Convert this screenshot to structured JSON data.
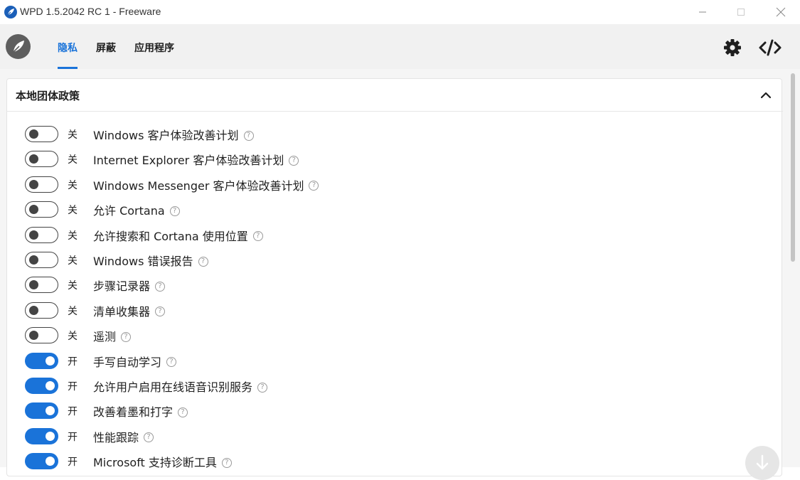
{
  "window": {
    "title": "WPD 1.5.2042 RC 1 - Freeware"
  },
  "icons": {
    "app": "feather-icon",
    "logo": "feather-icon",
    "settings": "gear-icon",
    "code": "code-icon",
    "collapse": "chevron-up-icon",
    "help": "help-circle-icon",
    "scroll": "arrow-down-icon"
  },
  "colors": {
    "accent": "#1a73d9",
    "toggle_off_border": "#444444"
  },
  "tabs": [
    {
      "label": "隐私",
      "active": true
    },
    {
      "label": "屏蔽",
      "active": false
    },
    {
      "label": "应用程序",
      "active": false
    }
  ],
  "panel": {
    "title": "本地团体政策"
  },
  "settings": [
    {
      "label": "Windows 客户体验改善计划",
      "state": "关",
      "on": false
    },
    {
      "label": "Internet Explorer 客户体验改善计划",
      "state": "关",
      "on": false
    },
    {
      "label": "Windows Messenger 客户体验改善计划",
      "state": "关",
      "on": false
    },
    {
      "label": "允许 Cortana",
      "state": "关",
      "on": false
    },
    {
      "label": "允许搜索和 Cortana 使用位置",
      "state": "关",
      "on": false
    },
    {
      "label": "Windows 错误报告",
      "state": "关",
      "on": false
    },
    {
      "label": "步骤记录器",
      "state": "关",
      "on": false
    },
    {
      "label": "清单收集器",
      "state": "关",
      "on": false
    },
    {
      "label": "遥测",
      "state": "关",
      "on": false
    },
    {
      "label": "手写自动学习",
      "state": "开",
      "on": true
    },
    {
      "label": "允许用户启用在线语音识别服务",
      "state": "开",
      "on": true
    },
    {
      "label": "改善着墨和打字",
      "state": "开",
      "on": true
    },
    {
      "label": "性能跟踪",
      "state": "开",
      "on": true
    },
    {
      "label": "Microsoft 支持诊断工具",
      "state": "开",
      "on": true
    }
  ],
  "help_glyph": "?"
}
